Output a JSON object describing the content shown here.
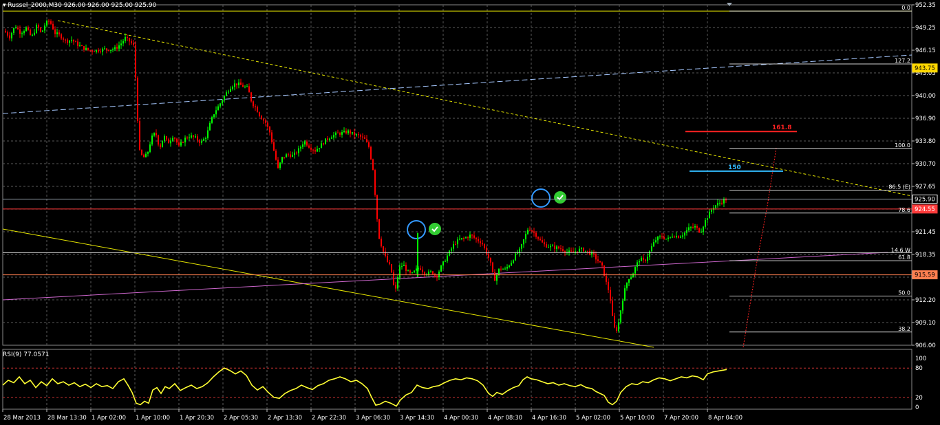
{
  "header": {
    "symbol": "Russel_2000,M30",
    "ohlc": "926.00 926.00 925.00 925.90"
  },
  "rsi_header": {
    "label": "RSI(9) 77.0571"
  },
  "colors": {
    "background": "#000000",
    "grid": "#5a5a5a",
    "bull": "#00ff00",
    "bear": "#ff0000",
    "trend": "#e6e600",
    "rsi": "#ffff33",
    "blue_circle": "#3399ff",
    "check": "#33cc33"
  },
  "chart_data": {
    "type": "candlestick",
    "symbol": "Russel_2000",
    "timeframe": "M30",
    "ylim": [
      906.0,
      952.35
    ],
    "y_ticks": [
      "952.35",
      "949.25",
      "946.15",
      "943.05",
      "940.00",
      "936.90",
      "933.80",
      "930.70",
      "927.65",
      "924.55",
      "921.45",
      "918.35",
      "915.25",
      "912.20",
      "909.10",
      "906.00"
    ],
    "x_ticks": [
      "28 Mar 2013",
      "28 Mar 13:30",
      "1 Apr 02:00",
      "1 Apr 10:00",
      "1 Apr 20:30",
      "2 Apr 05:30",
      "2 Apr 13:30",
      "2 Apr 22:30",
      "3 Apr 06:30",
      "3 Apr 14:30",
      "4 Apr 00:30",
      "4 Apr 08:30",
      "4 Apr 16:30",
      "5 Apr 02:00",
      "5 Apr 10:00",
      "7 Apr 20:00",
      "8 Apr 04:00"
    ],
    "price_path": [
      [
        0,
        946.2
      ],
      [
        6,
        948.8
      ],
      [
        14,
        948.0
      ],
      [
        22,
        949.5
      ],
      [
        30,
        948.5
      ],
      [
        38,
        949.2
      ],
      [
        46,
        947.9
      ],
      [
        54,
        949.6
      ],
      [
        60,
        948.4
      ],
      [
        66,
        949.8
      ],
      [
        72,
        950.2
      ],
      [
        80,
        948.5
      ],
      [
        88,
        948.1
      ],
      [
        96,
        947.4
      ],
      [
        104,
        947.6
      ],
      [
        112,
        947.0
      ],
      [
        120,
        946.5
      ],
      [
        128,
        946.2
      ],
      [
        136,
        946.1
      ],
      [
        144,
        946.2
      ],
      [
        152,
        946.3
      ],
      [
        160,
        946.3
      ],
      [
        168,
        946.4
      ],
      [
        176,
        947.1
      ],
      [
        182,
        947.8
      ],
      [
        188,
        947.4
      ],
      [
        194,
        946.8
      ],
      [
        198,
        941.0
      ],
      [
        202,
        932.5
      ],
      [
        208,
        931.5
      ],
      [
        214,
        932.0
      ],
      [
        220,
        934.2
      ],
      [
        226,
        935.0
      ],
      [
        232,
        932.8
      ],
      [
        238,
        934.5
      ],
      [
        244,
        933.5
      ],
      [
        252,
        934.6
      ],
      [
        260,
        933.0
      ],
      [
        268,
        934.1
      ],
      [
        276,
        934.5
      ],
      [
        284,
        934.2
      ],
      [
        292,
        933.6
      ],
      [
        300,
        934.5
      ],
      [
        306,
        936.4
      ],
      [
        312,
        937.8
      ],
      [
        318,
        938.6
      ],
      [
        324,
        939.6
      ],
      [
        330,
        940.5
      ],
      [
        336,
        941.3
      ],
      [
        342,
        941.6
      ],
      [
        348,
        941.5
      ],
      [
        354,
        941.2
      ],
      [
        360,
        941.0
      ],
      [
        366,
        939.0
      ],
      [
        372,
        938.3
      ],
      [
        378,
        937.2
      ],
      [
        386,
        936.3
      ],
      [
        392,
        935.0
      ],
      [
        398,
        932.5
      ],
      [
        404,
        930.0
      ],
      [
        410,
        931.5
      ],
      [
        418,
        932.0
      ],
      [
        426,
        931.8
      ],
      [
        434,
        932.6
      ],
      [
        442,
        933.8
      ],
      [
        450,
        933.0
      ],
      [
        458,
        932.5
      ],
      [
        466,
        933.2
      ],
      [
        474,
        934.0
      ],
      [
        482,
        934.5
      ],
      [
        490,
        934.8
      ],
      [
        498,
        934.9
      ],
      [
        506,
        935.1
      ],
      [
        514,
        934.7
      ],
      [
        522,
        934.5
      ],
      [
        530,
        934.0
      ],
      [
        536,
        933.0
      ],
      [
        542,
        930.0
      ],
      [
        546,
        925.5
      ],
      [
        550,
        921.0
      ],
      [
        556,
        919.0
      ],
      [
        562,
        917.5
      ],
      [
        568,
        916.5
      ],
      [
        574,
        913.0
      ],
      [
        580,
        916.5
      ],
      [
        586,
        917.0
      ],
      [
        592,
        916.0
      ],
      [
        598,
        915.6
      ],
      [
        604,
        916.2
      ],
      [
        610,
        916.6
      ],
      [
        616,
        915.9
      ],
      [
        622,
        915.8
      ],
      [
        628,
        916.0
      ],
      [
        634,
        915.3
      ],
      [
        640,
        916.5
      ],
      [
        646,
        917.5
      ],
      [
        652,
        918.5
      ],
      [
        660,
        919.8
      ],
      [
        668,
        920.4
      ],
      [
        676,
        920.6
      ],
      [
        684,
        921.0
      ],
      [
        692,
        920.4
      ],
      [
        700,
        920.0
      ],
      [
        706,
        918.8
      ],
      [
        712,
        917.5
      ],
      [
        718,
        914.8
      ],
      [
        726,
        916.5
      ],
      [
        734,
        916.3
      ],
      [
        742,
        917.2
      ],
      [
        750,
        918.4
      ],
      [
        756,
        919.0
      ],
      [
        762,
        920.6
      ],
      [
        768,
        922.0
      ],
      [
        774,
        921.5
      ],
      [
        780,
        920.9
      ],
      [
        786,
        920.1
      ],
      [
        792,
        919.6
      ],
      [
        800,
        919.4
      ],
      [
        808,
        919.3
      ],
      [
        816,
        919.1
      ],
      [
        824,
        918.7
      ],
      [
        832,
        918.6
      ],
      [
        840,
        919.0
      ],
      [
        848,
        919.0
      ],
      [
        856,
        918.6
      ],
      [
        862,
        918.4
      ],
      [
        866,
        917.8
      ],
      [
        870,
        917.4
      ],
      [
        876,
        916.5
      ],
      [
        880,
        914.8
      ],
      [
        886,
        913.0
      ],
      [
        890,
        909.8
      ],
      [
        894,
        907.8
      ],
      [
        898,
        908.5
      ],
      [
        902,
        910.8
      ],
      [
        906,
        912.8
      ],
      [
        910,
        914.3
      ],
      [
        914,
        915.2
      ],
      [
        918,
        915.4
      ],
      [
        924,
        916.8
      ],
      [
        930,
        917.8
      ],
      [
        936,
        917.4
      ],
      [
        942,
        918.3
      ],
      [
        948,
        919.6
      ],
      [
        954,
        920.5
      ],
      [
        962,
        920.8
      ],
      [
        970,
        920.4
      ],
      [
        978,
        921.0
      ],
      [
        986,
        920.8
      ],
      [
        994,
        921.2
      ],
      [
        1002,
        922.0
      ],
      [
        1010,
        922.1
      ],
      [
        1018,
        921.4
      ],
      [
        1024,
        922.8
      ],
      [
        1030,
        923.8
      ],
      [
        1036,
        924.8
      ],
      [
        1042,
        925.2
      ],
      [
        1050,
        925.6
      ],
      [
        1056,
        925.9
      ]
    ],
    "horizontal_levels": [
      {
        "price": 951.5,
        "color": "#e6e600"
      },
      {
        "price": 925.9,
        "color": "#9aa6b2"
      },
      {
        "price": 924.55,
        "color": "#ff3b3b"
      },
      {
        "price": 918.6,
        "color": "#c8c8c8"
      },
      {
        "price": 915.59,
        "color": "#ff7f50"
      }
    ],
    "price_tags": [
      {
        "label": "943.75",
        "price": 943.75,
        "bg": "#ffd700",
        "fg": "#000000"
      },
      {
        "label": "925.90",
        "price": 925.9,
        "bg": "#000000",
        "fg": "#ffffff"
      },
      {
        "label": "924.55",
        "price": 924.55,
        "bg": "#ff3b3b",
        "fg": "#ffffff"
      },
      {
        "label": "915.59",
        "price": 915.59,
        "bg": "#ff7f50",
        "fg": "#000000"
      }
    ],
    "fibonacci": [
      {
        "label": "0.0",
        "price": 951.5
      },
      {
        "label": "127.2",
        "price": 944.3
      },
      {
        "label": "100.0",
        "price": 932.8
      },
      {
        "label": "86.5 (E)",
        "price": 927.1
      },
      {
        "label": "78.6",
        "price": 924.0
      },
      {
        "label": "61.8",
        "price": 917.5
      },
      {
        "label": "50.0",
        "price": 912.7
      },
      {
        "label": "38.2",
        "price": 907.8
      }
    ],
    "fib_extra_label": {
      "label": "14.6 W",
      "price": 918.8
    },
    "annotations": [
      {
        "label": "161.8",
        "price": 935.1,
        "color": "#ff2222"
      },
      {
        "label": "150",
        "price": 929.7,
        "color": "#33bbff"
      }
    ],
    "rsi": {
      "name": "RSI(9)",
      "value": 77.0571,
      "levels": [
        80,
        20
      ],
      "y_ticks": [
        "100",
        "80",
        "20",
        "0"
      ],
      "path": [
        [
          4,
          45
        ],
        [
          12,
          55
        ],
        [
          20,
          50
        ],
        [
          28,
          62
        ],
        [
          36,
          48
        ],
        [
          44,
          55
        ],
        [
          52,
          40
        ],
        [
          60,
          52
        ],
        [
          68,
          44
        ],
        [
          76,
          58
        ],
        [
          84,
          48
        ],
        [
          92,
          52
        ],
        [
          100,
          45
        ],
        [
          108,
          50
        ],
        [
          116,
          42
        ],
        [
          124,
          47
        ],
        [
          132,
          40
        ],
        [
          140,
          48
        ],
        [
          148,
          42
        ],
        [
          156,
          44
        ],
        [
          164,
          38
        ],
        [
          172,
          52
        ],
        [
          180,
          58
        ],
        [
          186,
          45
        ],
        [
          192,
          30
        ],
        [
          198,
          8
        ],
        [
          204,
          5
        ],
        [
          210,
          12
        ],
        [
          216,
          8
        ],
        [
          222,
          35
        ],
        [
          228,
          40
        ],
        [
          234,
          28
        ],
        [
          240,
          42
        ],
        [
          246,
          38
        ],
        [
          254,
          48
        ],
        [
          262,
          34
        ],
        [
          270,
          40
        ],
        [
          278,
          45
        ],
        [
          286,
          38
        ],
        [
          294,
          42
        ],
        [
          302,
          50
        ],
        [
          310,
          62
        ],
        [
          318,
          72
        ],
        [
          326,
          80
        ],
        [
          334,
          75
        ],
        [
          342,
          68
        ],
        [
          350,
          74
        ],
        [
          358,
          65
        ],
        [
          366,
          45
        ],
        [
          374,
          35
        ],
        [
          382,
          42
        ],
        [
          390,
          30
        ],
        [
          398,
          20
        ],
        [
          406,
          18
        ],
        [
          414,
          28
        ],
        [
          422,
          34
        ],
        [
          430,
          38
        ],
        [
          438,
          45
        ],
        [
          446,
          40
        ],
        [
          454,
          36
        ],
        [
          462,
          44
        ],
        [
          470,
          48
        ],
        [
          478,
          55
        ],
        [
          486,
          58
        ],
        [
          494,
          62
        ],
        [
          502,
          58
        ],
        [
          510,
          52
        ],
        [
          518,
          55
        ],
        [
          526,
          48
        ],
        [
          534,
          38
        ],
        [
          540,
          20
        ],
        [
          546,
          4
        ],
        [
          552,
          6
        ],
        [
          560,
          12
        ],
        [
          568,
          8
        ],
        [
          576,
          2
        ],
        [
          582,
          15
        ],
        [
          590,
          25
        ],
        [
          598,
          30
        ],
        [
          606,
          45
        ],
        [
          614,
          40
        ],
        [
          622,
          38
        ],
        [
          630,
          42
        ],
        [
          638,
          44
        ],
        [
          646,
          50
        ],
        [
          654,
          55
        ],
        [
          662,
          58
        ],
        [
          670,
          56
        ],
        [
          678,
          60
        ],
        [
          686,
          58
        ],
        [
          694,
          54
        ],
        [
          702,
          45
        ],
        [
          710,
          28
        ],
        [
          716,
          22
        ],
        [
          722,
          30
        ],
        [
          730,
          26
        ],
        [
          738,
          34
        ],
        [
          746,
          40
        ],
        [
          754,
          44
        ],
        [
          760,
          56
        ],
        [
          766,
          62
        ],
        [
          772,
          58
        ],
        [
          780,
          56
        ],
        [
          788,
          52
        ],
        [
          796,
          48
        ],
        [
          804,
          50
        ],
        [
          812,
          45
        ],
        [
          820,
          48
        ],
        [
          828,
          44
        ],
        [
          836,
          42
        ],
        [
          844,
          46
        ],
        [
          852,
          40
        ],
        [
          860,
          38
        ],
        [
          866,
          32
        ],
        [
          872,
          28
        ],
        [
          878,
          24
        ],
        [
          884,
          10
        ],
        [
          890,
          5
        ],
        [
          896,
          12
        ],
        [
          902,
          30
        ],
        [
          910,
          42
        ],
        [
          918,
          48
        ],
        [
          926,
          46
        ],
        [
          934,
          52
        ],
        [
          942,
          50
        ],
        [
          950,
          56
        ],
        [
          958,
          60
        ],
        [
          966,
          58
        ],
        [
          974,
          54
        ],
        [
          982,
          58
        ],
        [
          990,
          62
        ],
        [
          998,
          60
        ],
        [
          1006,
          64
        ],
        [
          1014,
          62
        ],
        [
          1022,
          56
        ],
        [
          1028,
          68
        ],
        [
          1036,
          72
        ],
        [
          1044,
          74
        ],
        [
          1052,
          76
        ],
        [
          1056,
          77
        ]
      ]
    }
  }
}
